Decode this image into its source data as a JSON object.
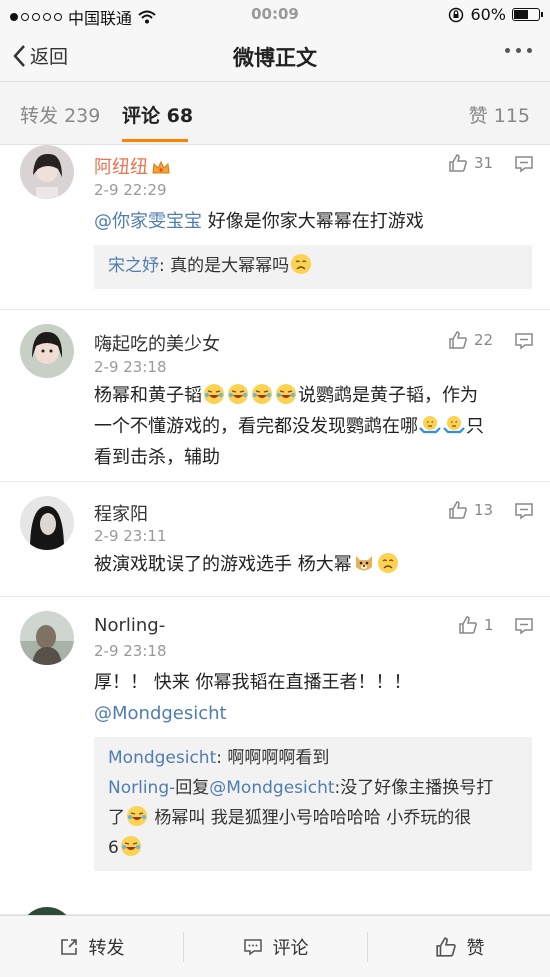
{
  "status_bar": {
    "carrier": "中国联通",
    "time": "00:09",
    "battery": "60%",
    "battery_level": 0.6
  },
  "nav": {
    "back_label": "返回",
    "title": "微博正文"
  },
  "tabs": {
    "repost": {
      "label": "转发",
      "count": "239"
    },
    "comment": {
      "label": "评论",
      "count": "68"
    },
    "like": {
      "label": "赞",
      "count": "115"
    }
  },
  "comments": [
    {
      "name": "阿纽纽",
      "time": "2-9 22:29",
      "likes": "31",
      "mention": "@你家雯宝宝",
      "text": " 好像是你家大幂幂在打游戏",
      "reply_user": "宋之妤",
      "reply_text": ": 真的是大幂幂吗"
    },
    {
      "name": "嗨起吃的美少女",
      "time": "2-9 23:18",
      "likes": "22",
      "text_1": "杨幂和黄子韬",
      "text_2": "说鹦鹉是黄子韬，作为",
      "text_3": "一个不懂游戏的，看完都没发现鹦鹉在哪",
      "text_4": "只",
      "text_5": "看到击杀，辅助"
    },
    {
      "name": "程家阳",
      "time": "2-9 23:11",
      "likes": "13",
      "text": "被演戏耽误了的游戏选手 杨大幂"
    },
    {
      "name": "Norling-",
      "time": "2-9 23:18",
      "likes": "1",
      "text": "厚！！ 快来 你幂我韬在直播王者！！！",
      "mention": "@Mondgesicht",
      "reply_1_user": "Mondgesicht",
      "reply_1_text": ": 啊啊啊啊看到",
      "reply_2_user": "Norling-",
      "reply_2_mid": "回复",
      "reply_2_mention": "@Mondgesicht",
      "reply_2_text": ":没了好像主播换号打",
      "reply_2_line2a": "了",
      "reply_2_line2b": " 杨幂叫 我是狐狸小号哈哈哈哈 小乔玩的很",
      "reply_2_line3": "6"
    }
  ],
  "bottom_bar": {
    "repost_label": "转发",
    "comment_label": "评论",
    "like_label": "赞"
  },
  "colors": {
    "accent": "#ff8200",
    "link": "#507daf",
    "vip_name": "#eb7350"
  }
}
